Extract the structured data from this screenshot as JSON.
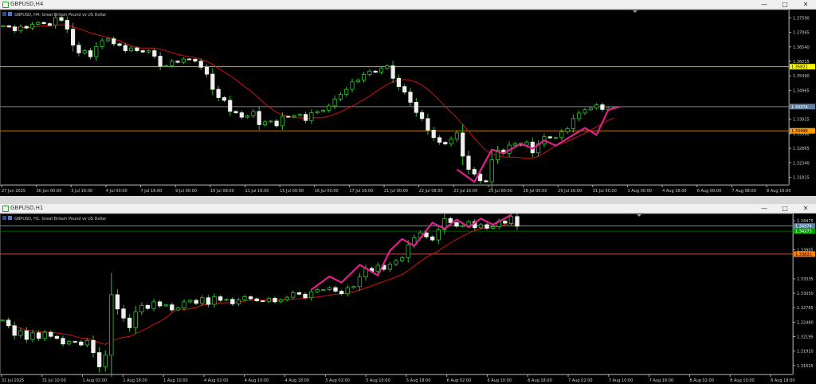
{
  "charts": [
    {
      "window_title": "GBPUSD,H4",
      "header_label": "GBPUSD, H4:  Great Britain Pound vs US Dollar",
      "prices": [
        "1.37590",
        "1.37065",
        "1.36540",
        "1.36015",
        "1.35490",
        "1.34965",
        "1.33915",
        "1.33390",
        "1.32865",
        "1.32340",
        "1.31815"
      ],
      "price_values": [
        1.3759,
        1.37065,
        1.3654,
        1.36015,
        1.3549,
        1.34965,
        1.33915,
        1.3339,
        1.32865,
        1.3234,
        1.31815
      ],
      "ylim": [
        1.3154,
        1.3789
      ],
      "markers": [
        {
          "label": "1.35821",
          "value": 1.35821,
          "bg": "#f5f500",
          "fg": "#000000",
          "line": "#b8b800"
        },
        {
          "label": "1.34374",
          "value": 1.34374,
          "bg": "#5f7f9f",
          "fg": "#ffffff",
          "line": "#7f7f7f"
        },
        {
          "label": "1.33496",
          "value": 1.33496,
          "bg": "#ff9a00",
          "fg": "#000000",
          "line": "#c08000"
        }
      ],
      "dates": [
        "27 Jun 2025",
        "30 Jun 00:00",
        "3 Jul 16:00",
        "4 Jul 00:00",
        "7 Jul 16:00",
        "9 Jul 00:00",
        "10 Jul 08:00",
        "11 Jul 16:00",
        "15 Jul 00:00",
        "16 Jul 00:00",
        "17 Jul 16:00",
        "21 Jul 00:00",
        "22 Jul 08:00",
        "23 Jul 16:00",
        "25 Jul 00:00",
        "28 Jul 00:00",
        "29 Jul 16:00",
        "31 Jul 00:00",
        "1 Aug 00:00",
        "4 Aug 16:00",
        "6 Aug 00:00",
        "7 Aug 08:00",
        "8 Aug 16:00"
      ],
      "closes": [
        1.373,
        1.3726,
        1.3712,
        1.3728,
        1.3722,
        1.3736,
        1.3742,
        1.3738,
        1.3732,
        1.376,
        1.375,
        1.3718,
        1.366,
        1.3632,
        1.364,
        1.3618,
        1.3655,
        1.3676,
        1.3683,
        1.3665,
        1.3659,
        1.364,
        1.365,
        1.364,
        1.3635,
        1.364,
        1.362,
        1.3584,
        1.3586,
        1.3602,
        1.3598,
        1.361,
        1.3609,
        1.3602,
        1.358,
        1.3555,
        1.35,
        1.347,
        1.346,
        1.342,
        1.3415,
        1.3399,
        1.3404,
        1.342,
        1.3372,
        1.3382,
        1.3385,
        1.3368,
        1.3402,
        1.34,
        1.3405,
        1.3409,
        1.3387,
        1.3415,
        1.342,
        1.3424,
        1.344,
        1.3465,
        1.3482,
        1.35,
        1.3527,
        1.3534,
        1.3554,
        1.3566,
        1.3562,
        1.3576,
        1.3585,
        1.354,
        1.351,
        1.349,
        1.3453,
        1.3416,
        1.3394,
        1.3352,
        1.3325,
        1.3308,
        1.3302,
        1.332,
        1.3342,
        1.3258,
        1.321,
        1.3193,
        1.3169,
        1.3165,
        1.3245,
        1.328,
        1.3268,
        1.3298,
        1.3304,
        1.3298,
        1.3309,
        1.327,
        1.3302,
        1.3328,
        1.3324,
        1.3325,
        1.3346,
        1.3358,
        1.3394,
        1.3414,
        1.3426,
        1.3432,
        1.3444,
        1.3427,
        1.3432,
        1.3434
      ],
      "zigzag": [
        [
          78,
          1.321
        ],
        [
          81,
          1.3165
        ],
        [
          84,
          1.3282
        ],
        [
          86,
          1.3268
        ],
        [
          89,
          1.3303
        ],
        [
          91,
          1.3285
        ],
        [
          93,
          1.3315
        ],
        [
          95,
          1.3296
        ],
        [
          97,
          1.3322
        ],
        [
          100,
          1.336
        ],
        [
          102,
          1.3335
        ],
        [
          104,
          1.3425
        ],
        [
          106,
          1.3437
        ]
      ]
    },
    {
      "window_title": "GBPUSD,H1",
      "header_label": "GBPUSD, H1:  Great Britain Pound vs US Dollar",
      "prices": [
        "1.34475",
        "1.33905",
        "1.33335",
        "1.33050",
        "1.32765",
        "1.32480",
        "1.32195",
        "1.31910",
        "1.31625"
      ],
      "price_values": [
        1.34475,
        1.33905,
        1.33335,
        1.3305,
        1.32765,
        1.3248,
        1.32195,
        1.3191,
        1.31625
      ],
      "ylim": [
        1.3145,
        1.3462
      ],
      "markers": [
        {
          "label": "1.34374",
          "value": 1.34374,
          "bg": "#5f7f9f",
          "fg": "#ffffff",
          "line": "#7f7f7f"
        },
        {
          "label": "1.34273",
          "value": 1.34273,
          "bg": "#00a000",
          "fg": "#ffffff",
          "line": "#006000"
        },
        {
          "label": "1.33821",
          "value": 1.33821,
          "bg": "#ff7f00",
          "fg": "#000000",
          "line": "#c05040"
        }
      ],
      "dates": [
        "31 Jul 2025",
        "31 Jul 10:00",
        "1 Aug 02:00",
        "1 Aug 18:00",
        "1 Aug 10:00",
        "4 Aug 02:00",
        "4 Aug 10:00",
        "4 Aug 18:00",
        "5 Aug 02:00",
        "5 Aug 10:00",
        "5 Aug 18:00",
        "6 Aug 02:00",
        "6 Aug 10:00",
        "6 Aug 18:00",
        "7 Aug 02:00",
        "7 Aug 10:00",
        "7 Aug 18:00",
        "8 Aug 02:00",
        "8 Aug 10:00",
        "8 Aug 18:00"
      ],
      "closes": [
        1.3252,
        1.3241,
        1.3222,
        1.3231,
        1.3214,
        1.3227,
        1.3216,
        1.3228,
        1.322,
        1.3216,
        1.3205,
        1.321,
        1.3209,
        1.3203,
        1.3212,
        1.3188,
        1.316,
        1.3183,
        1.3302,
        1.3274,
        1.3256,
        1.3237,
        1.3268,
        1.3281,
        1.3275,
        1.3288,
        1.328,
        1.3282,
        1.3272,
        1.3276,
        1.3288,
        1.3291,
        1.3285,
        1.3296,
        1.3283,
        1.3298,
        1.3291,
        1.3293,
        1.3284,
        1.3292,
        1.3298,
        1.3294,
        1.329,
        1.3289,
        1.3295,
        1.3288,
        1.3292,
        1.3297,
        1.3306,
        1.3303,
        1.3296,
        1.3308,
        1.3312,
        1.3312,
        1.3316,
        1.3309,
        1.3304,
        1.3316,
        1.3318,
        1.3337,
        1.3354,
        1.3348,
        1.336,
        1.3352,
        1.3362,
        1.3369,
        1.3375,
        1.34,
        1.3414,
        1.3424,
        1.3416,
        1.341,
        1.343,
        1.3452,
        1.3444,
        1.3437,
        1.3438,
        1.3446,
        1.3434,
        1.344,
        1.3433,
        1.3436,
        1.3447,
        1.3443,
        1.3456,
        1.3437
      ],
      "zigzag": [
        [
          51,
          1.3312
        ],
        [
          54,
          1.3338
        ],
        [
          56,
          1.3326
        ],
        [
          59,
          1.3361
        ],
        [
          62,
          1.334
        ],
        [
          64,
          1.3389
        ],
        [
          66,
          1.3412
        ],
        [
          68,
          1.3398
        ],
        [
          71,
          1.3444
        ],
        [
          73,
          1.3432
        ],
        [
          75,
          1.345
        ],
        [
          77,
          1.3435
        ],
        [
          79,
          1.3452
        ],
        [
          81,
          1.344
        ],
        [
          84,
          1.3459
        ]
      ]
    }
  ]
}
